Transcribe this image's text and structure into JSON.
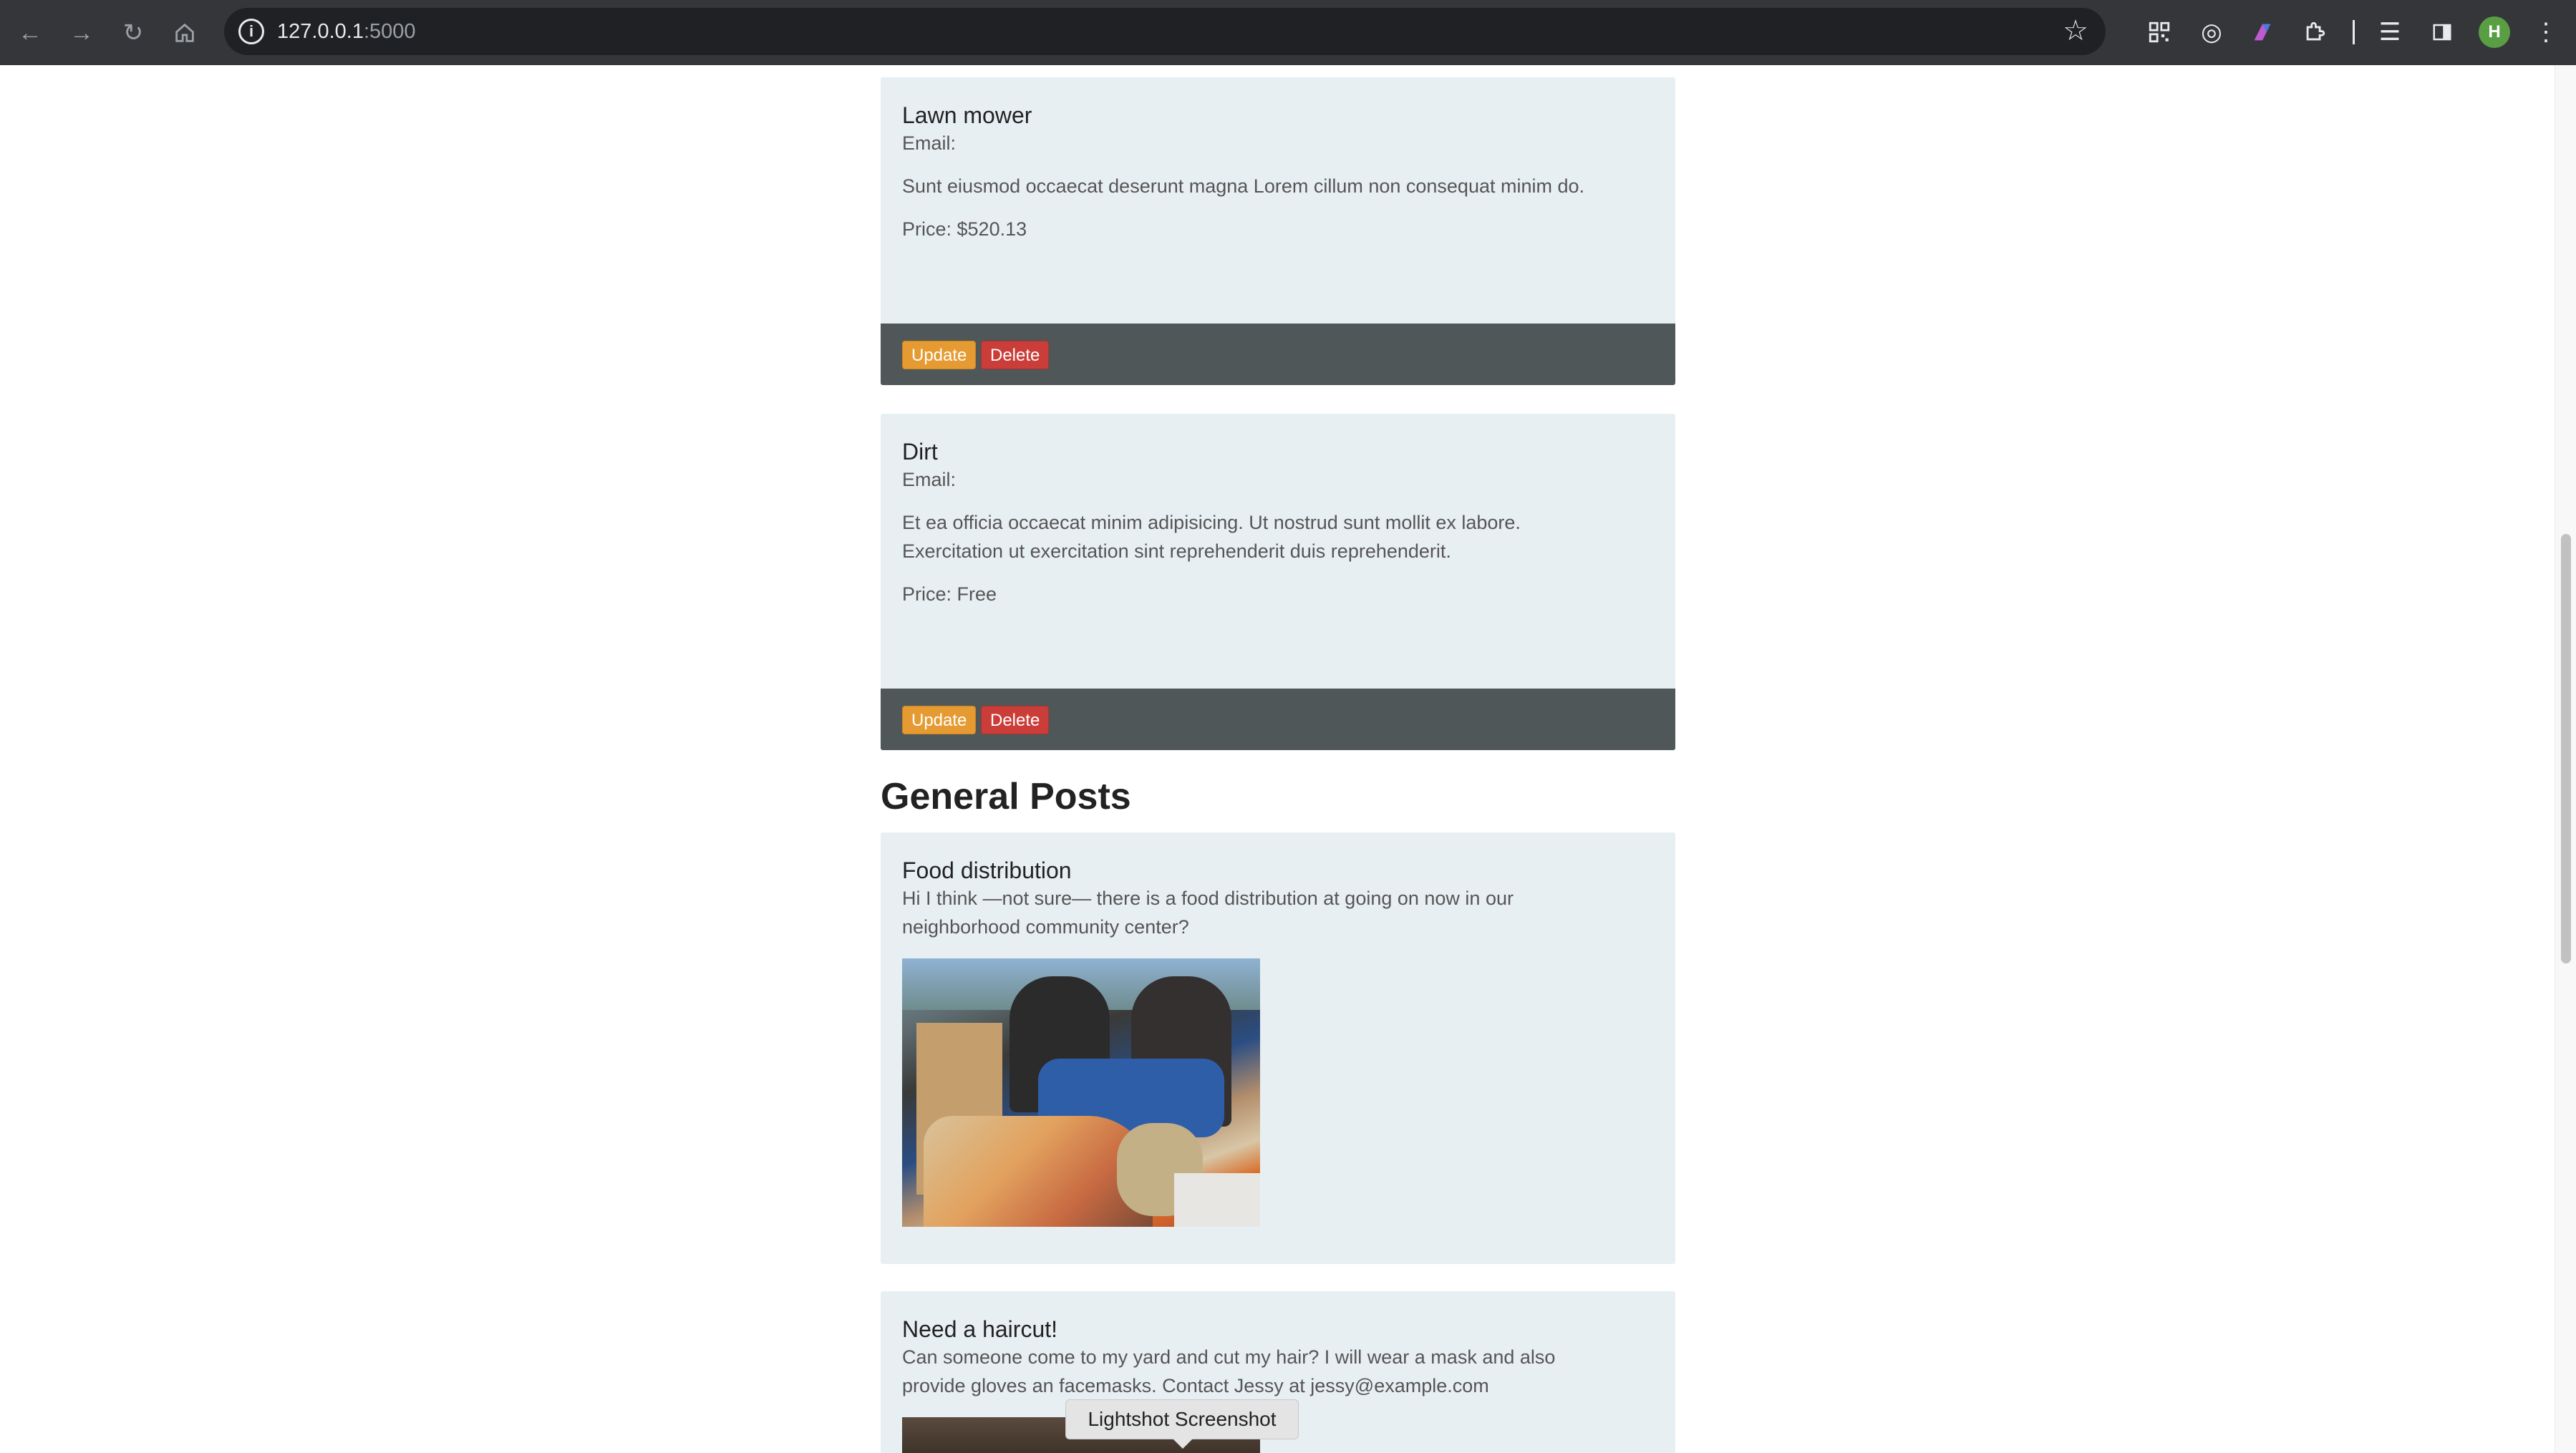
{
  "browser": {
    "url_host": "127.0.0.1",
    "url_port": ":5000",
    "avatar_initial": "H",
    "icons": [
      "back-arrow-icon",
      "forward-arrow-icon",
      "reload-icon",
      "home-icon",
      "info-icon",
      "bookmark-star-icon",
      "qr-code-icon",
      "target-icon",
      "flag-extension-icon",
      "puzzle-extensions-icon",
      "media-queue-icon",
      "side-panel-icon",
      "kebab-menu-icon"
    ],
    "accent_color": "#5a9e43"
  },
  "items": [
    {
      "title": "Lawn mower",
      "email_label": "Email:",
      "description": "Sunt eiusmod occaecat deserunt magna Lorem cillum non consequat minim do.",
      "price": "Price: $520.13",
      "update_label": "Update",
      "delete_label": "Delete"
    },
    {
      "title": "Dirt",
      "email_label": "Email:",
      "description": "Et ea officia occaecat minim adipisicing. Ut nostrud sunt mollit ex labore. Exercitation ut exercitation sint reprehenderit duis reprehenderit.",
      "price": "Price: Free",
      "update_label": "Update",
      "delete_label": "Delete"
    }
  ],
  "general": {
    "heading": "General Posts",
    "posts": [
      {
        "title": "Food distribution",
        "body": "Hi I think —not sure— there is a food distribution at going on now in our neighborhood community center?"
      },
      {
        "title": "Need a haircut!",
        "body": "Can someone come to my yard and cut my hair? I will wear a mask and also provide gloves an facemasks. Contact Jessy at jessy@example.com"
      }
    ]
  },
  "tooltip": {
    "text": "Lightshot Screenshot"
  },
  "colors": {
    "card_bg": "#e8eff3",
    "footer_bg": "#4f5759",
    "update_button": "#e69b32",
    "delete_button": "#cb3d38"
  }
}
